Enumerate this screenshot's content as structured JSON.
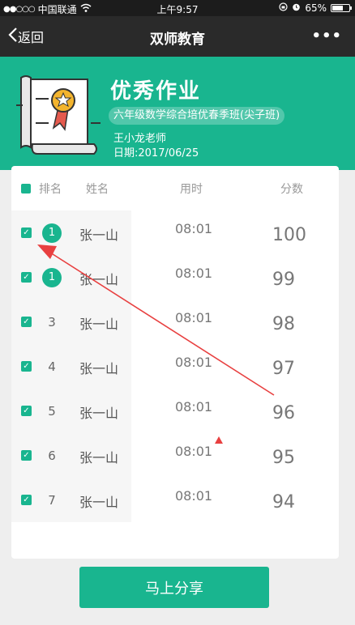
{
  "status_bar": {
    "carrier": "中国联通",
    "time": "上午9:57",
    "battery": "65%",
    "battery_level": 0.65
  },
  "navbar": {
    "back_label": "返回",
    "title": "双师教育",
    "more_label": "•••"
  },
  "header": {
    "title": "优秀作业",
    "class_name": "六年级数学综合培优春季班(尖子班)",
    "teacher": "王小龙老师",
    "date": "日期:2017/06/25"
  },
  "table": {
    "columns": {
      "rank": "排名",
      "name": "姓名",
      "time": "用时",
      "score": "分数"
    },
    "rows": [
      {
        "rank": "1",
        "name": "张一山",
        "time": "08:01",
        "score": "100",
        "badge": true
      },
      {
        "rank": "1",
        "name": "张一山",
        "time": "08:01",
        "score": "99",
        "badge": true
      },
      {
        "rank": "3",
        "name": "张一山",
        "time": "08:01",
        "score": "98",
        "badge": false
      },
      {
        "rank": "4",
        "name": "张一山",
        "time": "08:01",
        "score": "97",
        "badge": false
      },
      {
        "rank": "5",
        "name": "张一山",
        "time": "08:01",
        "score": "96",
        "badge": false
      },
      {
        "rank": "6",
        "name": "张一山",
        "time": "08:01",
        "score": "95",
        "badge": false
      },
      {
        "rank": "7",
        "name": "张一山",
        "time": "08:01",
        "score": "94",
        "badge": false
      }
    ]
  },
  "share_label": "马上分享",
  "colors": {
    "accent": "#19b58f",
    "annotation": "#e84040"
  }
}
